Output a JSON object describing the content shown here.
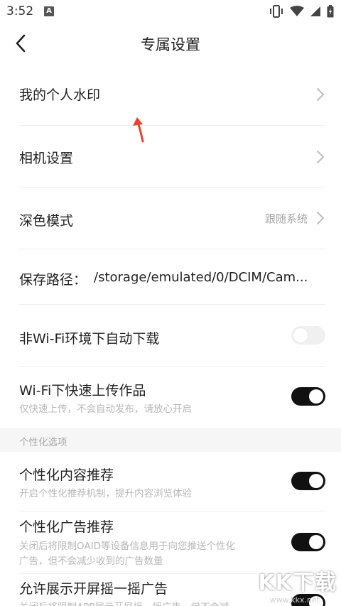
{
  "status_bar": {
    "time": "3:52",
    "notif_letter": "A"
  },
  "nav": {
    "title": "专属设置"
  },
  "rows": {
    "watermark": {
      "label": "我的个人水印"
    },
    "camera": {
      "label": "相机设置"
    },
    "dark_mode": {
      "label": "深色模式",
      "value": "跟随系统"
    },
    "save_path": {
      "label": "保存路径：",
      "value": "/storage/emulated/0/DCIM/Cam..."
    },
    "non_wifi_download": {
      "label": "非Wi-Fi环境下自动下载",
      "enabled": false
    },
    "wifi_upload": {
      "label": "Wi-Fi下快速上传作品",
      "sub": "仅快速上传，不会自动发布，请放心开启",
      "enabled": true
    }
  },
  "section": {
    "title": "个性化选项"
  },
  "personal": {
    "content_rec": {
      "label": "个性化内容推荐",
      "sub": "开启个性化推荐机制，提升内容浏览体验",
      "enabled": true
    },
    "ad_rec": {
      "label": "个性化广告推荐",
      "sub_line1": "关闭后将限制OAID等设备信息用于向您推送个性化",
      "sub_line2": "广告，但不会减少收到的广告数量",
      "enabled": true
    },
    "shake_ad": {
      "label": "允许展示开屏摇一摇广告",
      "sub": "关闭后将限制APP展示开屏摇一摇广告，但不会减",
      "enabled": true
    }
  },
  "overlay": {
    "watermark_text": "KK下载",
    "watermark_url": "www.kkx.net"
  },
  "colors": {
    "toggle_on": "#111111",
    "toggle_off": "#f0f0f0",
    "annotation_arrow": "#e8432e"
  }
}
